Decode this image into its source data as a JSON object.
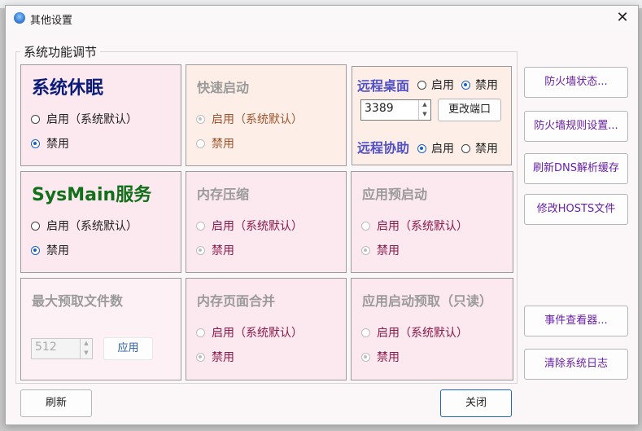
{
  "window": {
    "title": "其他设置",
    "close_glyph": "✕"
  },
  "group_label": "系统功能调节",
  "sleep": {
    "title": "系统休眠",
    "opt_enable": "启用（系统默认）",
    "opt_disable": "禁用"
  },
  "fast_boot": {
    "title": "快速启动",
    "opt_enable": "启用（系统默认）",
    "opt_disable": "禁用"
  },
  "remote": {
    "desktop_title": "远程桌面",
    "desktop_enable": "启用",
    "desktop_disable": "禁用",
    "port": "3389",
    "change_port": "更改端口",
    "assist_title": "远程协助",
    "assist_enable": "启用",
    "assist_disable": "禁用"
  },
  "sysmain": {
    "title": "SysMain服务",
    "opt_enable": "启用（系统默认）",
    "opt_disable": "禁用"
  },
  "mem_compress": {
    "title": "内存压缩",
    "opt_enable": "启用（系统默认）",
    "opt_disable": "禁用"
  },
  "app_prelaunch": {
    "title": "应用预启动",
    "opt_enable": "启用（系统默认）",
    "opt_disable": "禁用"
  },
  "max_prefetch": {
    "title": "最大预取文件数",
    "value": "512",
    "apply": "应用"
  },
  "page_combine": {
    "title": "内存页面合并",
    "opt_enable": "启用（系统默认）",
    "opt_disable": "禁用"
  },
  "launch_prefetch": {
    "title": "应用启动预取（只读）",
    "opt_enable": "启用（系统默认）",
    "opt_disable": "禁用"
  },
  "side": {
    "firewall_status": "防火墙状态...",
    "firewall_rules": "防火墙规则设置...",
    "flush_dns": "刷新DNS解析缓存",
    "edit_hosts": "修改HOSTS文件",
    "event_viewer": "事件查看器...",
    "clear_logs": "清除系统日志"
  },
  "footer": {
    "refresh": "刷新",
    "close": "关闭"
  }
}
